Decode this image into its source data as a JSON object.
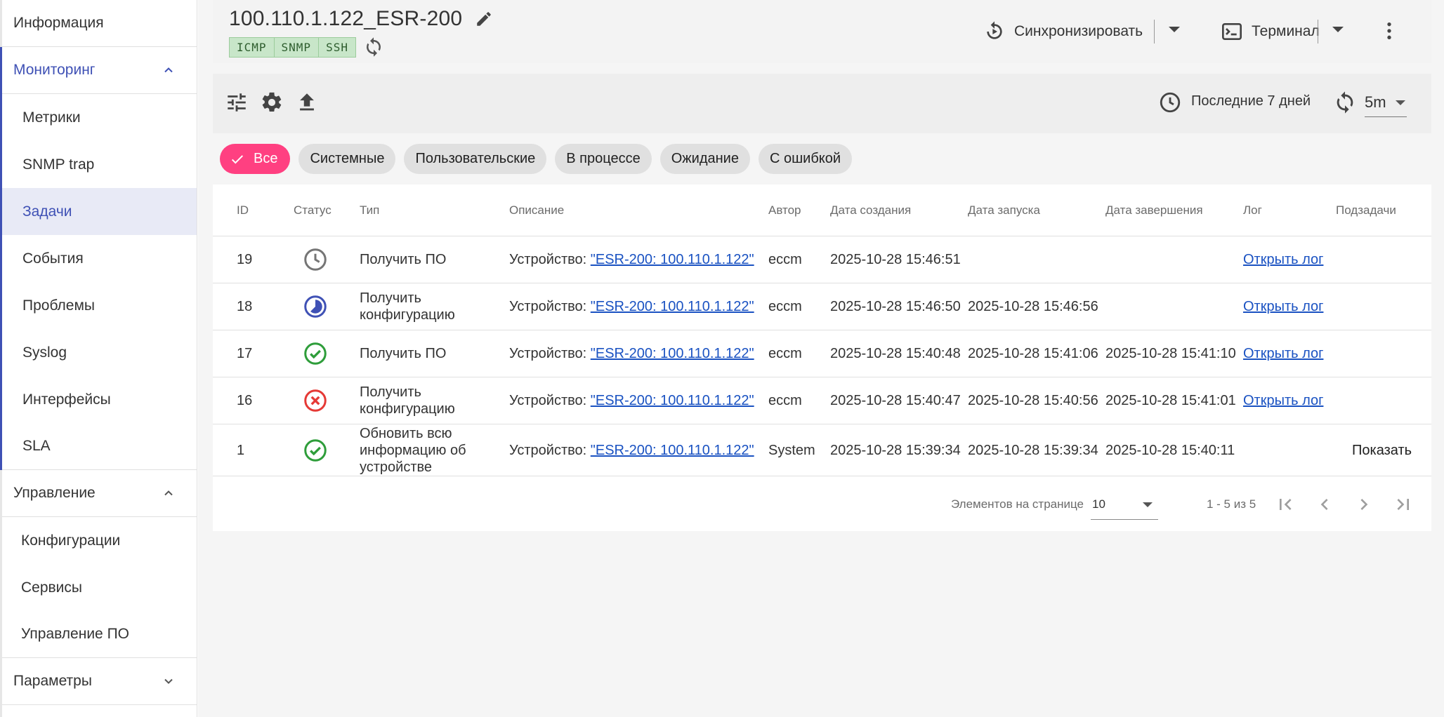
{
  "sidebar": {
    "info": "Информация",
    "monitoring": "Мониторинг",
    "monitoring_items": [
      "Метрики",
      "SNMP trap",
      "Задачи",
      "События",
      "Проблемы",
      "Syslog",
      "Интерфейсы",
      "SLA"
    ],
    "management": "Управление",
    "management_items": [
      "Конфигурации",
      "Сервисы",
      "Управление ПО"
    ],
    "params": "Параметры",
    "selected": "Задачи"
  },
  "header": {
    "title": "100.110.1.122_ESR-200",
    "badges": [
      "ICMP",
      "SNMP",
      "SSH"
    ],
    "sync_label": "Синхронизировать",
    "terminal_label": "Терминал"
  },
  "toolbar": {
    "period_label": "Последние 7 дней",
    "refresh_interval": "5m"
  },
  "filters": [
    "Все",
    "Системные",
    "Пользовательские",
    "В процессе",
    "Ожидание",
    "С ошибкой"
  ],
  "table": {
    "columns": [
      "ID",
      "Статус",
      "Тип",
      "Описание",
      "Автор",
      "Дата создания",
      "Дата запуска",
      "Дата завершения",
      "Лог",
      "Подзадачи"
    ],
    "desc_prefix": "Устройство: ",
    "rows": [
      {
        "id": "19",
        "status": "pending",
        "type": "Получить ПО",
        "device": "\"ESR-200: 100.110.1.122\"",
        "author": "eccm",
        "created": "2025-10-28 15:46:51",
        "started": "",
        "finished": "",
        "log": "Открыть лог",
        "subtasks": ""
      },
      {
        "id": "18",
        "status": "running",
        "type": "Получить конфигурацию",
        "device": "\"ESR-200: 100.110.1.122\"",
        "author": "eccm",
        "created": "2025-10-28 15:46:50",
        "started": "2025-10-28 15:46:56",
        "finished": "",
        "log": "Открыть лог",
        "subtasks": ""
      },
      {
        "id": "17",
        "status": "success",
        "type": "Получить ПО",
        "device": "\"ESR-200: 100.110.1.122\"",
        "author": "eccm",
        "created": "2025-10-28 15:40:48",
        "started": "2025-10-28 15:41:06",
        "finished": "2025-10-28 15:41:10",
        "log": "Открыть лог",
        "subtasks": ""
      },
      {
        "id": "16",
        "status": "error",
        "type": "Получить конфигурацию",
        "device": "\"ESR-200: 100.110.1.122\"",
        "author": "eccm",
        "created": "2025-10-28 15:40:47",
        "started": "2025-10-28 15:40:56",
        "finished": "2025-10-28 15:41:01",
        "log": "Открыть лог",
        "subtasks": ""
      },
      {
        "id": "1",
        "status": "success",
        "type": "Обновить всю информацию об устройстве",
        "device": "\"ESR-200: 100.110.1.122\"",
        "author": "System",
        "created": "2025-10-28 15:39:34",
        "started": "2025-10-28 15:39:34",
        "finished": "2025-10-28 15:40:11",
        "log": "",
        "subtasks": "Показать"
      }
    ]
  },
  "pager": {
    "per_page_label": "Элементов на странице",
    "per_page": "10",
    "range": "1 - 5 из 5"
  },
  "colors": {
    "accent": "#3f51b5",
    "chip_active": "#ff4081",
    "success": "#2e9d3a",
    "error": "#e53935",
    "pending": "#757575",
    "link": "#1a52c2"
  }
}
